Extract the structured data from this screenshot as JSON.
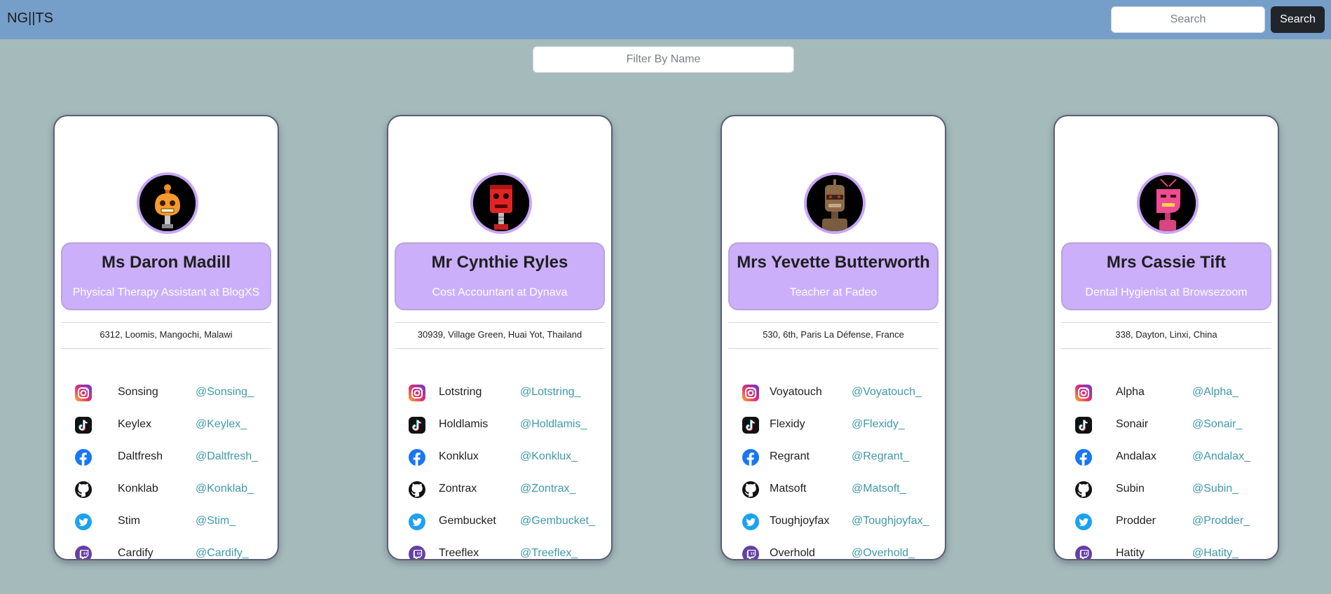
{
  "navbar": {
    "brand": "NG||TS",
    "search_placeholder": "Search",
    "search_button": "Search"
  },
  "filter": {
    "placeholder": "Filter By Name"
  },
  "networks": [
    "instagram",
    "tiktok",
    "facebook",
    "github",
    "twitter",
    "twitch"
  ],
  "colors": {
    "background": "#a5bbbb",
    "navbar": "#759ec9",
    "name_box": "#cbaffb",
    "avatar_ring": "#c8a6f7",
    "handle": "#3e9aa8"
  },
  "cards": [
    {
      "name": "Ms Daron Madill",
      "job": "Physical Therapy Assistant at BlogXS",
      "address": "6312, Loomis, Mangochi, Malawi",
      "avatar": "orange-robot",
      "socials": [
        {
          "network": "instagram",
          "name": "Sonsing",
          "handle": "@Sonsing_"
        },
        {
          "network": "tiktok",
          "name": "Keylex",
          "handle": "@Keylex_"
        },
        {
          "network": "facebook",
          "name": "Daltfresh",
          "handle": "@Daltfresh_"
        },
        {
          "network": "github",
          "name": "Konklab",
          "handle": "@Konklab_"
        },
        {
          "network": "twitter",
          "name": "Stim",
          "handle": "@Stim_"
        },
        {
          "network": "twitch",
          "name": "Cardify",
          "handle": "@Cardify_"
        }
      ]
    },
    {
      "name": "Mr Cynthie Ryles",
      "job": "Cost Accountant at Dynava",
      "address": "30939, Village Green, Huai Yot, Thailand",
      "avatar": "red-robot",
      "socials": [
        {
          "network": "instagram",
          "name": "Lotstring",
          "handle": "@Lotstring_"
        },
        {
          "network": "tiktok",
          "name": "Holdlamis",
          "handle": "@Holdlamis_"
        },
        {
          "network": "facebook",
          "name": "Konklux",
          "handle": "@Konklux_"
        },
        {
          "network": "github",
          "name": "Zontrax",
          "handle": "@Zontrax_"
        },
        {
          "network": "twitter",
          "name": "Gembucket",
          "handle": "@Gembucket_"
        },
        {
          "network": "twitch",
          "name": "Treeflex",
          "handle": "@Treeflex_"
        }
      ]
    },
    {
      "name": "Mrs Yevette Butterworth",
      "job": "Teacher at Fadeo",
      "address": "530, 6th, Paris La Défense, France",
      "avatar": "brown-robot",
      "socials": [
        {
          "network": "instagram",
          "name": "Voyatouch",
          "handle": "@Voyatouch_"
        },
        {
          "network": "tiktok",
          "name": "Flexidy",
          "handle": "@Flexidy_"
        },
        {
          "network": "facebook",
          "name": "Regrant",
          "handle": "@Regrant_"
        },
        {
          "network": "github",
          "name": "Matsoft",
          "handle": "@Matsoft_"
        },
        {
          "network": "twitter",
          "name": "Toughjoyfax",
          "handle": "@Toughjoyfax_"
        },
        {
          "network": "twitch",
          "name": "Overhold",
          "handle": "@Overhold_"
        }
      ]
    },
    {
      "name": "Mrs Cassie Tift",
      "job": "Dental Hygienist at Browsezoom",
      "address": "338, Dayton, Linxi, China",
      "avatar": "pink-robot",
      "socials": [
        {
          "network": "instagram",
          "name": "Alpha",
          "handle": "@Alpha_"
        },
        {
          "network": "tiktok",
          "name": "Sonair",
          "handle": "@Sonair_"
        },
        {
          "network": "facebook",
          "name": "Andalax",
          "handle": "@Andalax_"
        },
        {
          "network": "github",
          "name": "Subin",
          "handle": "@Subin_"
        },
        {
          "network": "twitter",
          "name": "Prodder",
          "handle": "@Prodder_"
        },
        {
          "network": "twitch",
          "name": "Hatity",
          "handle": "@Hatity_"
        }
      ]
    }
  ]
}
